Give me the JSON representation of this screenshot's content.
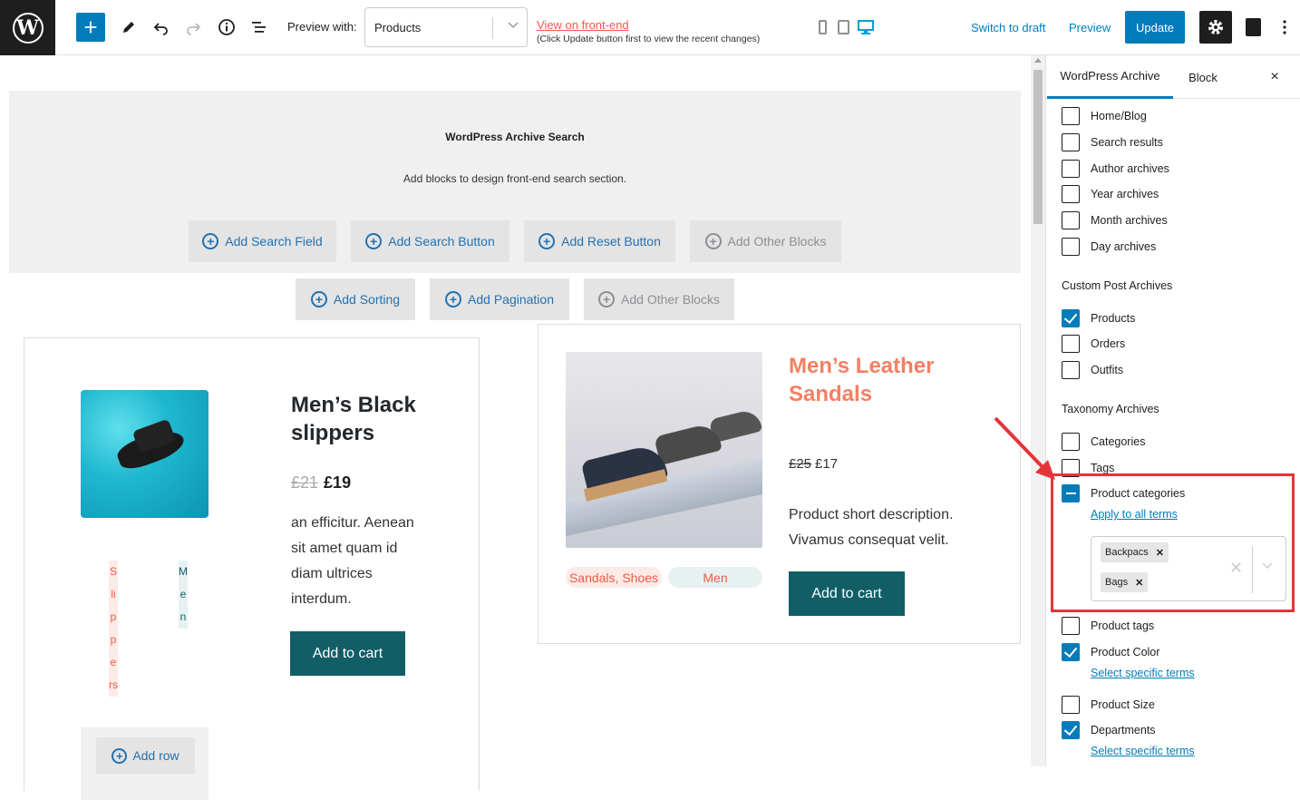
{
  "toolbar": {
    "logo": "W",
    "add_icon": "+",
    "preview_label": "Preview with:",
    "preview_value": "Products",
    "view_frontend": "View on front-end",
    "view_note": "(Click Update button first to view the recent changes)",
    "switch_draft": "Switch to draft",
    "preview": "Preview",
    "update": "Update",
    "icons": [
      "pencil-icon",
      "undo-icon",
      "redo-icon",
      "info-icon",
      "list-view-icon",
      "mobile-icon",
      "tablet-icon",
      "desktop-icon",
      "gear-icon",
      "plugin-icon",
      "more-icon"
    ]
  },
  "search": {
    "title": "WordPress Archive Search",
    "subtitle": "Add blocks to design front-end search section.",
    "buttons": [
      "Add Search Field",
      "Add Search Button",
      "Add Reset Button",
      "Add Other Blocks"
    ],
    "buttons2": [
      "Add Sorting",
      "Add Pagination",
      "Add Other Blocks"
    ]
  },
  "products": [
    {
      "title": "Men’s Black slippers",
      "old_price": "£21",
      "price": "£19",
      "description": "an efficitur. Aenean sit amet quam id diam ultrices interdum.",
      "cart": "Add to cart",
      "category": "Slippers",
      "department": "Men"
    },
    {
      "title": "Men’s Leather Sandals",
      "old_price": "£25",
      "price": "£17",
      "description": "Product short description. Vivamus consequat velit.",
      "cart": "Add to cart",
      "category": "Sandals, Shoes",
      "department": "Men"
    }
  ],
  "add_row": "Add row",
  "sidebar": {
    "tab_archive": "WordPress Archive",
    "tab_block": "Block",
    "close": "×",
    "archives": [
      "Home/Blog",
      "Search results",
      "Author archives",
      "Year archives",
      "Month archives",
      "Day archives"
    ],
    "custom_title": "Custom Post Archives",
    "custom": [
      "Products",
      "Orders",
      "Outfits"
    ],
    "taxonomy_title": "Taxonomy Archives",
    "taxonomy": [
      "Categories",
      "Tags",
      "Product categories",
      "Product tags",
      "Product Color",
      "Product Size",
      "Departments"
    ],
    "apply_all": "Apply to all terms",
    "select_specific": "Select specific terms",
    "terms": [
      "Backpacs",
      "Bags"
    ]
  },
  "colors": {
    "accent": "#007cba",
    "product_button": "#115e67",
    "sale_title": "#f57f62",
    "highlight": "#e4343a"
  }
}
